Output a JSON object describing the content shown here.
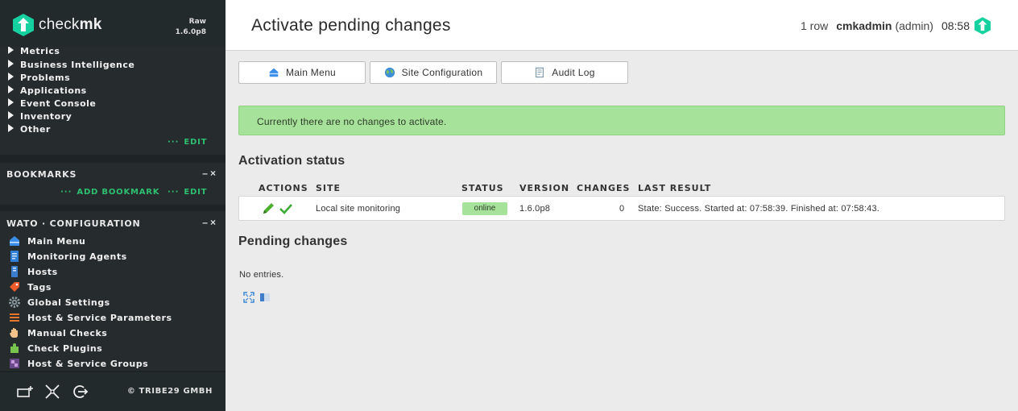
{
  "sidebar": {
    "logo": {
      "prefix": "check",
      "suffix": "mk"
    },
    "edition": "Raw",
    "version": "1.6.0p8",
    "views": {
      "items": [
        "Metrics",
        "Business Intelligence",
        "Problems",
        "Applications",
        "Event Console",
        "Inventory",
        "Other"
      ],
      "edit_label": "EDIT"
    },
    "bookmarks": {
      "title": "BOOKMARKS",
      "add_label": "ADD BOOKMARK",
      "edit_label": "EDIT"
    },
    "wato": {
      "title": "WATO · CONFIGURATION",
      "items": [
        {
          "label": "Main Menu",
          "icon": "main-menu-icon"
        },
        {
          "label": "Monitoring Agents",
          "icon": "agents-icon"
        },
        {
          "label": "Hosts",
          "icon": "hosts-icon"
        },
        {
          "label": "Tags",
          "icon": "tags-icon"
        },
        {
          "label": "Global Settings",
          "icon": "gear-icon"
        },
        {
          "label": "Host & Service Parameters",
          "icon": "rulesets-icon"
        },
        {
          "label": "Manual Checks",
          "icon": "hand-icon"
        },
        {
          "label": "Check Plugins",
          "icon": "puzzle-icon"
        },
        {
          "label": "Host & Service Groups",
          "icon": "groups-icon"
        }
      ]
    },
    "footer": {
      "copyright": "© TRIBE29 GMBH"
    }
  },
  "header": {
    "title": "Activate pending changes",
    "row_count": "1 row",
    "user": "cmkadmin",
    "role": "(admin)",
    "time": "08:58"
  },
  "nav_buttons": {
    "main_menu": "Main Menu",
    "site_config": "Site Configuration",
    "audit_log": "Audit Log"
  },
  "message": "Currently there are no changes to activate.",
  "activation": {
    "heading": "Activation status",
    "columns": [
      "ACTIONS",
      "SITE",
      "STATUS",
      "VERSION",
      "CHANGES",
      "LAST RESULT"
    ],
    "row": {
      "site": "Local site monitoring",
      "status": "online",
      "version": "1.6.0p8",
      "changes": "0",
      "last_result": "State: Success. Started at: 07:58:39. Finished at: 07:58:43."
    }
  },
  "pending": {
    "heading": "Pending changes",
    "empty_text": "No entries."
  },
  "colors": {
    "sidebar_bg": "#1e2426",
    "accent_green": "#2fbf71",
    "success_bg": "#a7e29a"
  }
}
